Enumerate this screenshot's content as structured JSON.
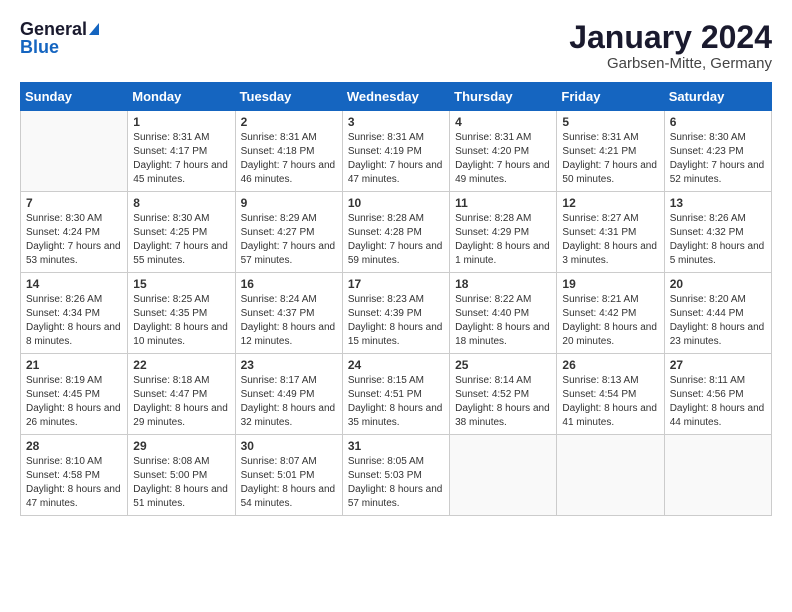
{
  "header": {
    "logo_general": "General",
    "logo_blue": "Blue",
    "month_title": "January 2024",
    "location": "Garbsen-Mitte, Germany"
  },
  "days_of_week": [
    "Sunday",
    "Monday",
    "Tuesday",
    "Wednesday",
    "Thursday",
    "Friday",
    "Saturday"
  ],
  "weeks": [
    [
      {
        "day": "",
        "info": ""
      },
      {
        "day": "1",
        "info": "Sunrise: 8:31 AM\nSunset: 4:17 PM\nDaylight: 7 hours\nand 45 minutes."
      },
      {
        "day": "2",
        "info": "Sunrise: 8:31 AM\nSunset: 4:18 PM\nDaylight: 7 hours\nand 46 minutes."
      },
      {
        "day": "3",
        "info": "Sunrise: 8:31 AM\nSunset: 4:19 PM\nDaylight: 7 hours\nand 47 minutes."
      },
      {
        "day": "4",
        "info": "Sunrise: 8:31 AM\nSunset: 4:20 PM\nDaylight: 7 hours\nand 49 minutes."
      },
      {
        "day": "5",
        "info": "Sunrise: 8:31 AM\nSunset: 4:21 PM\nDaylight: 7 hours\nand 50 minutes."
      },
      {
        "day": "6",
        "info": "Sunrise: 8:30 AM\nSunset: 4:23 PM\nDaylight: 7 hours\nand 52 minutes."
      }
    ],
    [
      {
        "day": "7",
        "info": "Sunrise: 8:30 AM\nSunset: 4:24 PM\nDaylight: 7 hours\nand 53 minutes."
      },
      {
        "day": "8",
        "info": "Sunrise: 8:30 AM\nSunset: 4:25 PM\nDaylight: 7 hours\nand 55 minutes."
      },
      {
        "day": "9",
        "info": "Sunrise: 8:29 AM\nSunset: 4:27 PM\nDaylight: 7 hours\nand 57 minutes."
      },
      {
        "day": "10",
        "info": "Sunrise: 8:28 AM\nSunset: 4:28 PM\nDaylight: 7 hours\nand 59 minutes."
      },
      {
        "day": "11",
        "info": "Sunrise: 8:28 AM\nSunset: 4:29 PM\nDaylight: 8 hours\nand 1 minute."
      },
      {
        "day": "12",
        "info": "Sunrise: 8:27 AM\nSunset: 4:31 PM\nDaylight: 8 hours\nand 3 minutes."
      },
      {
        "day": "13",
        "info": "Sunrise: 8:26 AM\nSunset: 4:32 PM\nDaylight: 8 hours\nand 5 minutes."
      }
    ],
    [
      {
        "day": "14",
        "info": "Sunrise: 8:26 AM\nSunset: 4:34 PM\nDaylight: 8 hours\nand 8 minutes."
      },
      {
        "day": "15",
        "info": "Sunrise: 8:25 AM\nSunset: 4:35 PM\nDaylight: 8 hours\nand 10 minutes."
      },
      {
        "day": "16",
        "info": "Sunrise: 8:24 AM\nSunset: 4:37 PM\nDaylight: 8 hours\nand 12 minutes."
      },
      {
        "day": "17",
        "info": "Sunrise: 8:23 AM\nSunset: 4:39 PM\nDaylight: 8 hours\nand 15 minutes."
      },
      {
        "day": "18",
        "info": "Sunrise: 8:22 AM\nSunset: 4:40 PM\nDaylight: 8 hours\nand 18 minutes."
      },
      {
        "day": "19",
        "info": "Sunrise: 8:21 AM\nSunset: 4:42 PM\nDaylight: 8 hours\nand 20 minutes."
      },
      {
        "day": "20",
        "info": "Sunrise: 8:20 AM\nSunset: 4:44 PM\nDaylight: 8 hours\nand 23 minutes."
      }
    ],
    [
      {
        "day": "21",
        "info": "Sunrise: 8:19 AM\nSunset: 4:45 PM\nDaylight: 8 hours\nand 26 minutes."
      },
      {
        "day": "22",
        "info": "Sunrise: 8:18 AM\nSunset: 4:47 PM\nDaylight: 8 hours\nand 29 minutes."
      },
      {
        "day": "23",
        "info": "Sunrise: 8:17 AM\nSunset: 4:49 PM\nDaylight: 8 hours\nand 32 minutes."
      },
      {
        "day": "24",
        "info": "Sunrise: 8:15 AM\nSunset: 4:51 PM\nDaylight: 8 hours\nand 35 minutes."
      },
      {
        "day": "25",
        "info": "Sunrise: 8:14 AM\nSunset: 4:52 PM\nDaylight: 8 hours\nand 38 minutes."
      },
      {
        "day": "26",
        "info": "Sunrise: 8:13 AM\nSunset: 4:54 PM\nDaylight: 8 hours\nand 41 minutes."
      },
      {
        "day": "27",
        "info": "Sunrise: 8:11 AM\nSunset: 4:56 PM\nDaylight: 8 hours\nand 44 minutes."
      }
    ],
    [
      {
        "day": "28",
        "info": "Sunrise: 8:10 AM\nSunset: 4:58 PM\nDaylight: 8 hours\nand 47 minutes."
      },
      {
        "day": "29",
        "info": "Sunrise: 8:08 AM\nSunset: 5:00 PM\nDaylight: 8 hours\nand 51 minutes."
      },
      {
        "day": "30",
        "info": "Sunrise: 8:07 AM\nSunset: 5:01 PM\nDaylight: 8 hours\nand 54 minutes."
      },
      {
        "day": "31",
        "info": "Sunrise: 8:05 AM\nSunset: 5:03 PM\nDaylight: 8 hours\nand 57 minutes."
      },
      {
        "day": "",
        "info": ""
      },
      {
        "day": "",
        "info": ""
      },
      {
        "day": "",
        "info": ""
      }
    ]
  ]
}
